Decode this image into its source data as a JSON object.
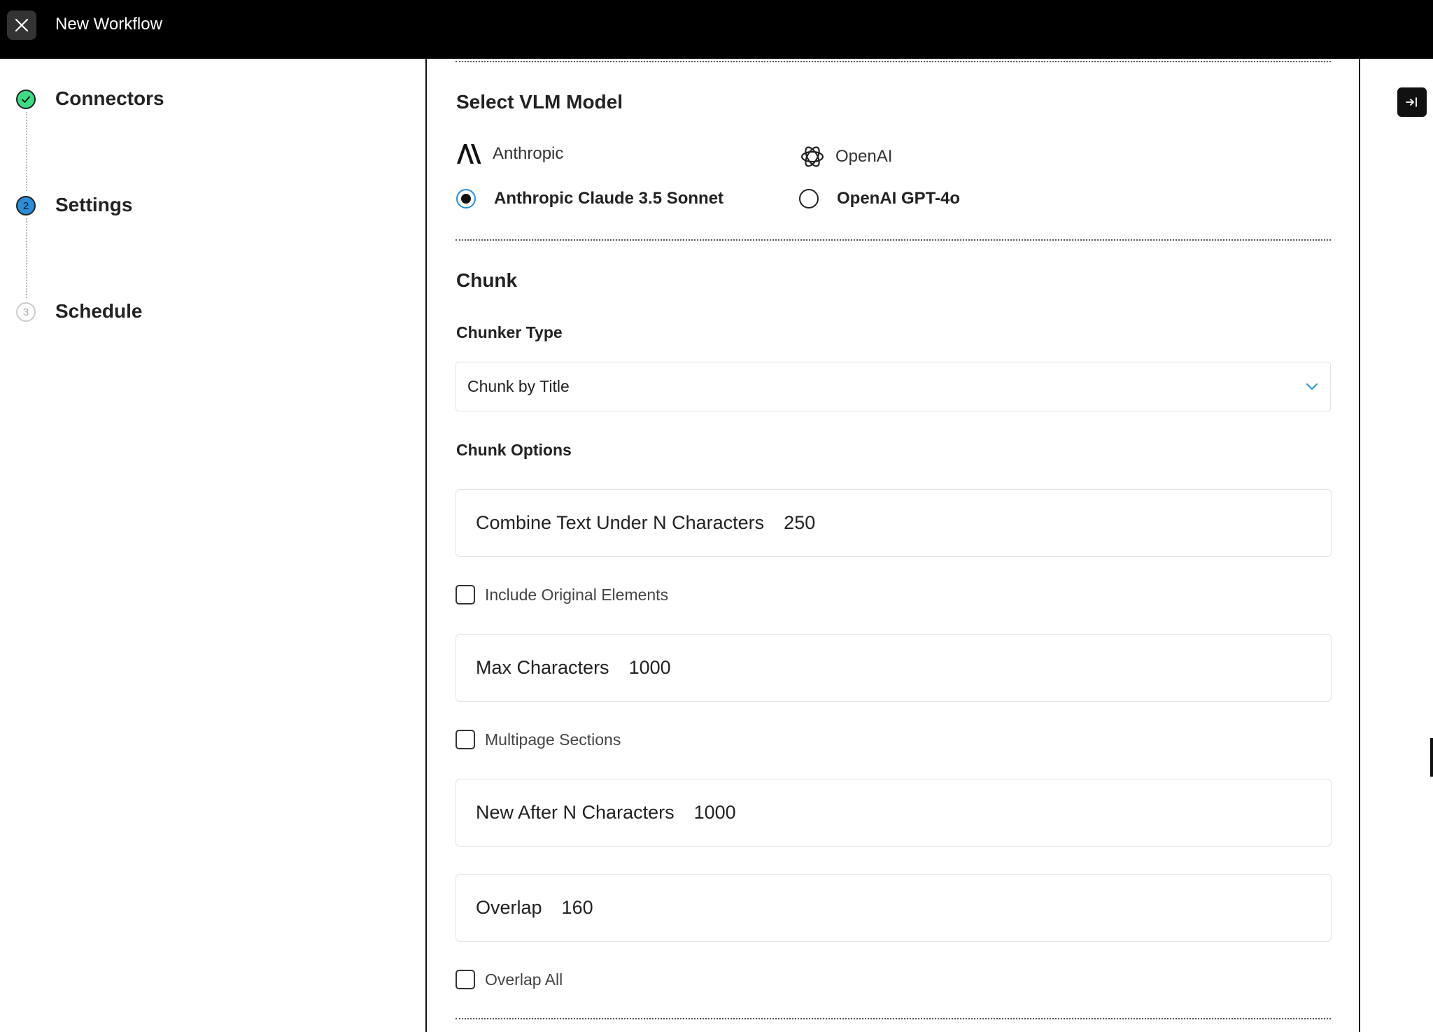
{
  "header": {
    "title": "New Workflow",
    "close_icon": "close-icon"
  },
  "steps": [
    {
      "label": "Connectors",
      "status": "complete",
      "marker": ""
    },
    {
      "label": "Settings",
      "status": "active",
      "marker": "2"
    },
    {
      "label": "Schedule",
      "status": "pending",
      "marker": "3"
    }
  ],
  "vlm": {
    "heading": "Select VLM Model",
    "providers": [
      {
        "name": "Anthropic",
        "icon": "anthropic-logo-icon"
      },
      {
        "name": "OpenAI",
        "icon": "openai-logo-icon"
      }
    ],
    "models": [
      {
        "label": "Anthropic Claude 3.5 Sonnet",
        "selected": true
      },
      {
        "label": "OpenAI GPT-4o",
        "selected": false
      }
    ]
  },
  "chunk": {
    "heading": "Chunk",
    "chunker_type_label": "Chunker Type",
    "chunker_type_value": "Chunk by Title",
    "options_label": "Chunk Options",
    "combine_text": {
      "label": "Combine Text Under N Characters",
      "value": "250"
    },
    "include_original": {
      "label": "Include Original Elements",
      "checked": false
    },
    "max_characters": {
      "label": "Max Characters",
      "value": "1000"
    },
    "multipage": {
      "label": "Multipage Sections",
      "checked": false
    },
    "new_after": {
      "label": "New After N Characters",
      "value": "1000"
    },
    "overlap": {
      "label": "Overlap",
      "value": "160"
    },
    "overlap_all": {
      "label": "Overlap All",
      "checked": false
    }
  },
  "colors": {
    "step_complete": "#3ddc84",
    "step_active": "#2a8ed8",
    "accent": "#2a8ed8"
  }
}
